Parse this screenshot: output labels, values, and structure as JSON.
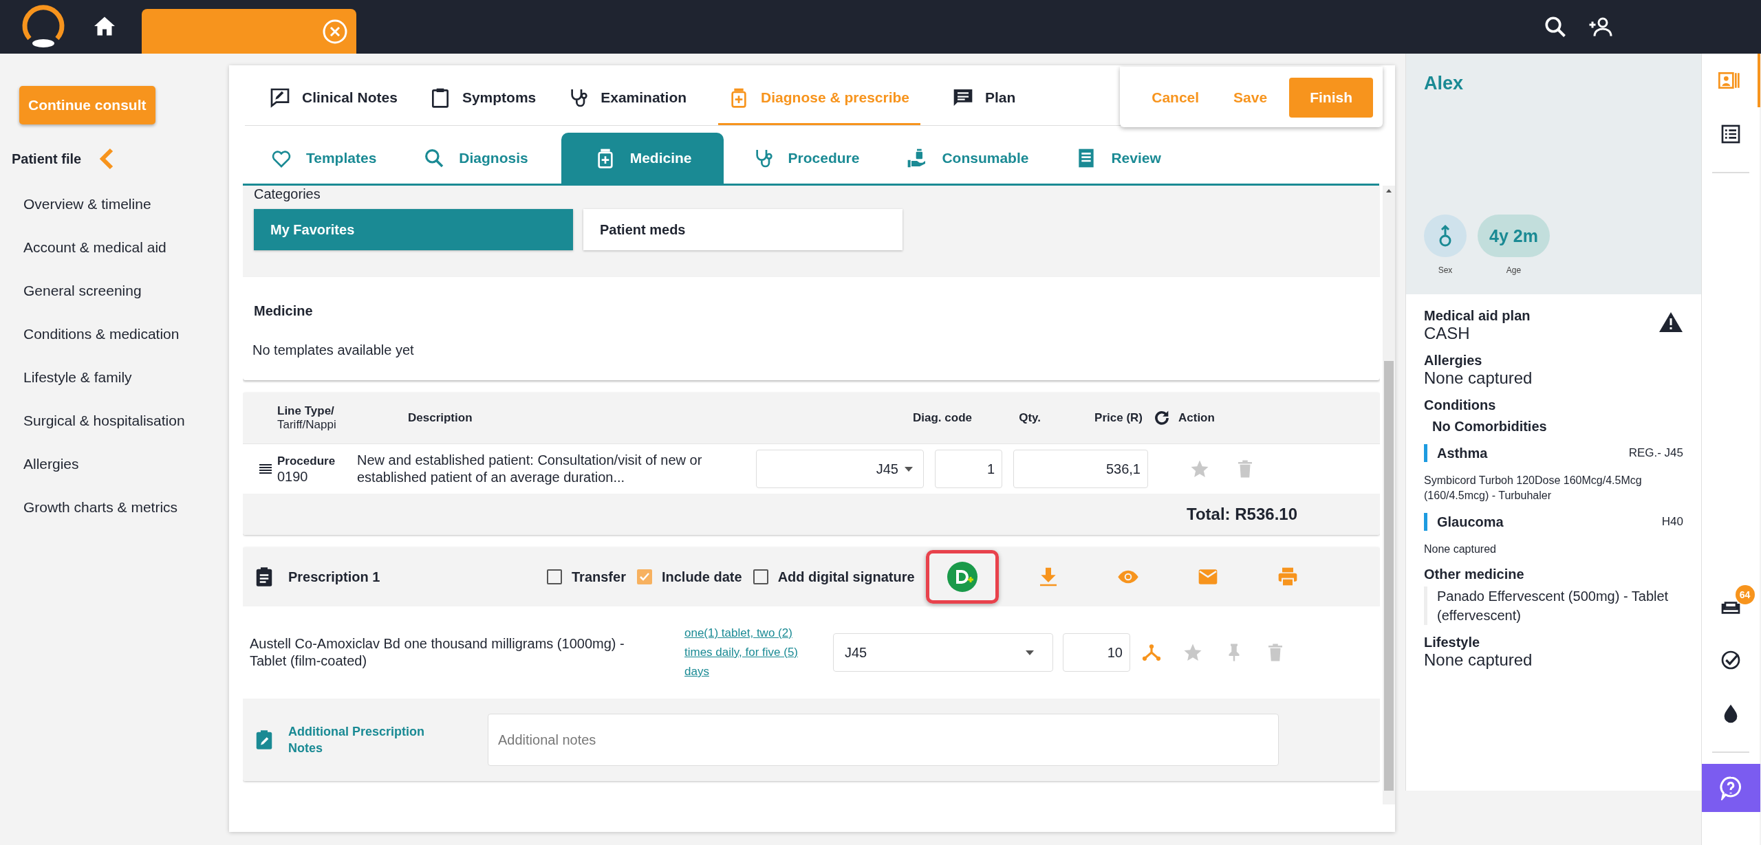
{
  "sidebar": {
    "button": "Continue consult",
    "title": "Patient file",
    "items": [
      {
        "label": "Overview & timeline"
      },
      {
        "label": "Account & medical aid"
      },
      {
        "label": "General screening"
      },
      {
        "label": "Conditions & medication"
      },
      {
        "label": "Lifestyle & family"
      },
      {
        "label": "Surgical & hospitalisation"
      },
      {
        "label": "Allergies"
      },
      {
        "label": "Growth charts & metrics"
      }
    ]
  },
  "main_tabs": [
    {
      "label": "Clinical Notes",
      "selected": false
    },
    {
      "label": "Symptoms",
      "selected": false
    },
    {
      "label": "Examination",
      "selected": false
    },
    {
      "label": "Diagnose & prescribe",
      "selected": true
    },
    {
      "label": "Plan",
      "selected": false
    }
  ],
  "actions": [
    {
      "label": "Cancel",
      "kind": "text"
    },
    {
      "label": "Save",
      "kind": "text"
    },
    {
      "label": "Finish",
      "kind": "primary"
    }
  ],
  "sub_tabs": [
    {
      "label": "Templates",
      "selected": false
    },
    {
      "label": "Diagnosis",
      "selected": false
    },
    {
      "label": "Medicine",
      "selected": true
    },
    {
      "label": "Procedure",
      "selected": false
    },
    {
      "label": "Consumable",
      "selected": false
    },
    {
      "label": "Review",
      "selected": false
    }
  ],
  "categories": {
    "title": "Categories",
    "options": [
      {
        "label": "My Favorites",
        "selected": true
      },
      {
        "label": "Patient meds",
        "selected": false
      }
    ]
  },
  "templates": {
    "title": "Medicine",
    "empty": "No templates available yet"
  },
  "lines_table": {
    "columns": [
      {
        "label": "Line Type/",
        "sublabel": "Tariff/Nappi"
      },
      {
        "label": "Description"
      },
      {
        "label": "Diag. code"
      },
      {
        "label": "Qty."
      },
      {
        "label": "Price (R)"
      },
      {
        "label": "Action"
      }
    ],
    "rows": [
      {
        "line_type": "Procedure",
        "code": "0190",
        "description": "New and established patient: Consultation/visit of new or established patient of an average duration...",
        "diag_code": "J45",
        "qty": "1",
        "price": "536,1"
      }
    ],
    "total": "Total: R536.10"
  },
  "prescription": {
    "title": "Prescription 1",
    "highlight_dispense": true,
    "options": [
      {
        "label": "Transfer",
        "checked": false
      },
      {
        "label": "Include date",
        "checked": true
      },
      {
        "label": "Add digital signature",
        "checked": false
      }
    ],
    "items": [
      {
        "name": "Austell Co-Amoxiclav Bd one thousand milligrams (1000mg) - Tablet (film-coated)",
        "directions": "one(1) tablet, two (2) times daily, for five (5) days",
        "diag_code": "J45",
        "qty": "10"
      }
    ],
    "notes": {
      "label": "Additional Prescription Notes",
      "placeholder": "Additional notes"
    }
  },
  "patient": {
    "name": "Alex",
    "sex_label": "Sex",
    "age": "4y 2m",
    "age_label": "Age"
  },
  "summary": {
    "medical_aid": {
      "title": "Medical aid plan",
      "value": "CASH"
    },
    "allergies": {
      "title": "Allergies",
      "value": "None captured"
    },
    "conditions": {
      "title": "Conditions",
      "note": "No Comorbidities",
      "items": [
        {
          "name": "Asthma",
          "code": "REG.- J45",
          "medicine": "Symbicord Turboh 120Dose 160Mcg/4.5Mcg (160/4.5mcg) - Turbuhaler"
        },
        {
          "name": "Glaucoma",
          "code": "H40",
          "medicine": "None captured"
        }
      ]
    },
    "other_medicine": {
      "title": "Other medicine",
      "items": [
        "Panado Effervescent (500mg) - Tablet (effervescent)"
      ]
    },
    "lifestyle": {
      "title": "Lifestyle",
      "value": "None captured"
    }
  },
  "rail": {
    "badge": "64"
  }
}
